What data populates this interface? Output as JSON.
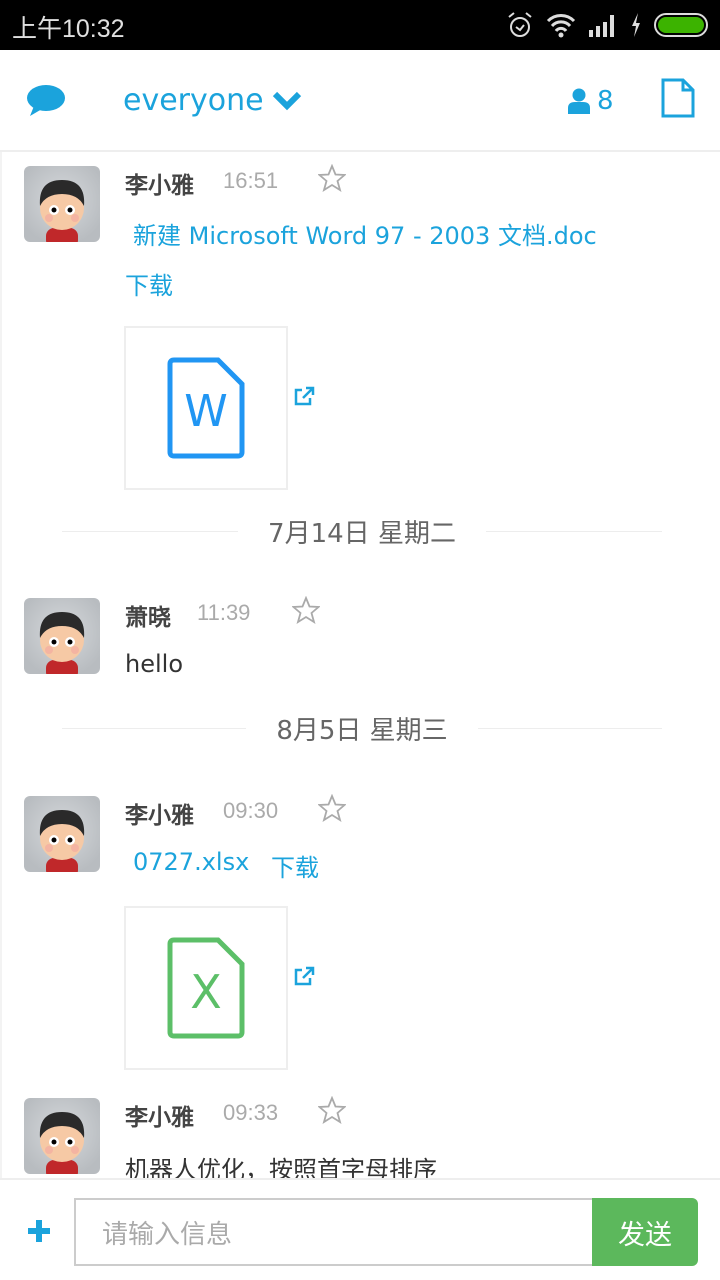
{
  "statusbar": {
    "time": "上午10:32",
    "icons": [
      "alarm-icon",
      "wifi-icon",
      "signal-icon",
      "charging-icon",
      "battery-icon"
    ],
    "battery_color": "#3cb300"
  },
  "header": {
    "channel": "everyone",
    "member_count": "8",
    "accent": "#1ba3dc"
  },
  "messages": [
    {
      "sender": "李小雅",
      "time": "16:51",
      "file_name": "新建 Microsoft Word 97 - 2003 文档.doc",
      "download_label": "下载",
      "file_type": "word",
      "file_letter": "W",
      "file_color": "#2196f3"
    },
    {
      "divider": "7月14日 星期二"
    },
    {
      "sender": "萧晓",
      "time": "11:39",
      "text": "hello"
    },
    {
      "divider": "8月5日 星期三"
    },
    {
      "sender": "李小雅",
      "time": "09:30",
      "file_name": "0727.xlsx",
      "download_label": "下载",
      "file_type": "excel",
      "file_letter": "X",
      "file_color": "#5cbf68"
    },
    {
      "sender": "李小雅",
      "time": "09:33",
      "text": "机器人优化，按照首字母排序"
    }
  ],
  "footer": {
    "input_placeholder": "请输入信息",
    "send_label": "发送",
    "send_color": "#5cb85c"
  }
}
